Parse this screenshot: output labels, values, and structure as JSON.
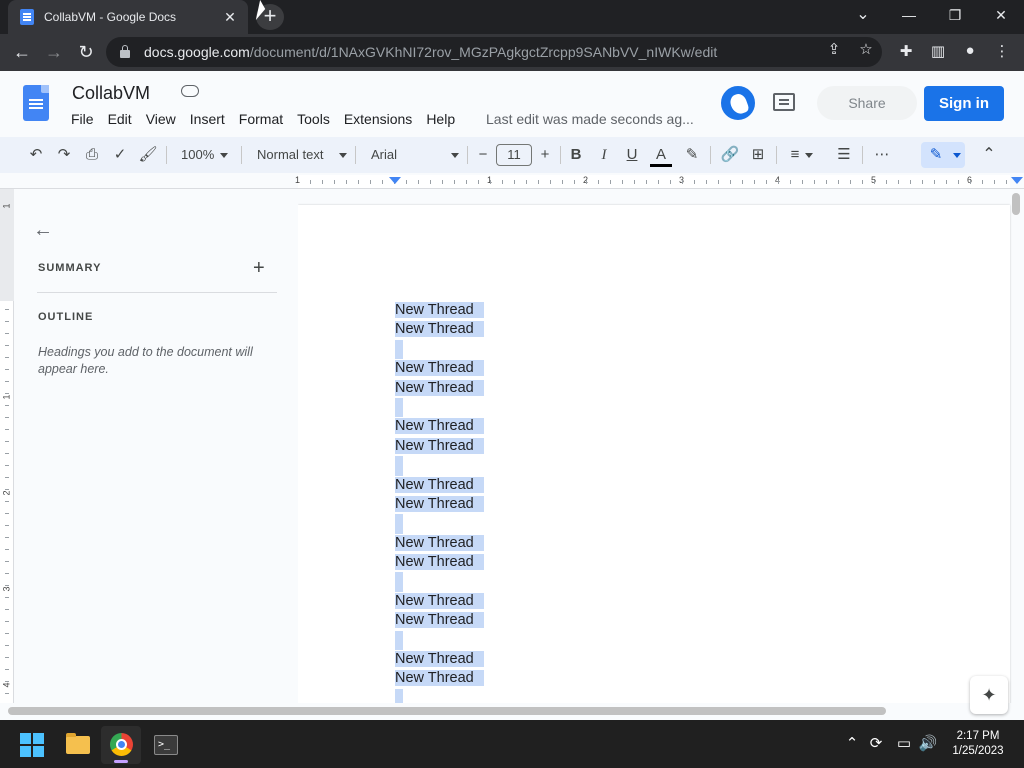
{
  "browser": {
    "tab_title": "CollabVM - Google Docs",
    "tab_close": "✕",
    "new_tab": "+",
    "url_host": "docs.google.com",
    "url_path": "/document/d/1NAxGVKhNI72rov_MGzPAgkgctZrcpp9SANbVV_nIWKw/edit",
    "window_controls": {
      "dropdown": "⌄",
      "minimize": "—",
      "restore": "❐",
      "close": "✕"
    },
    "nav": {
      "back": "←",
      "forward": "→",
      "reload": "↻"
    }
  },
  "docs": {
    "title": "CollabVM",
    "menu": [
      "File",
      "Edit",
      "View",
      "Insert",
      "Format",
      "Tools",
      "Extensions",
      "Help"
    ],
    "last_edit": "Last edit was made seconds ag...",
    "share_label": "Share",
    "signin_label": "Sign in"
  },
  "toolbar": {
    "zoom": "100%",
    "style": "Normal text",
    "font": "Arial",
    "font_size": "11",
    "minus": "−",
    "plus": "+",
    "bold": "B",
    "italic": "I",
    "underline": "U",
    "text_color": "A",
    "more": "⋯",
    "collapse": "⌃"
  },
  "ruler": {
    "labels": [
      "1",
      "1",
      "2",
      "3",
      "4",
      "5",
      "6"
    ],
    "vertical_labels": [
      "1",
      "1",
      "2",
      "3",
      "4"
    ]
  },
  "outline_panel": {
    "summary_label": "SUMMARY",
    "add": "+",
    "outline_label": "OUTLINE",
    "hint": "Headings you add to the document will appear here."
  },
  "document": {
    "lines": [
      "New Thread",
      "New Thread",
      "",
      "New Thread",
      "New Thread",
      "",
      "New Thread",
      "New Thread",
      "",
      "New Thread",
      "New Thread",
      "",
      "New Thread",
      "New Thread",
      "",
      "New Thread",
      "New Thread",
      "",
      "New Thread",
      "New Thread",
      ""
    ]
  },
  "taskbar": {
    "time": "2:17 PM",
    "date": "1/25/2023",
    "terminal_glyph": ">_"
  },
  "colors": {
    "accent": "#1a73e8",
    "selection": "#c6d9f7",
    "taskbar": "#202020"
  }
}
